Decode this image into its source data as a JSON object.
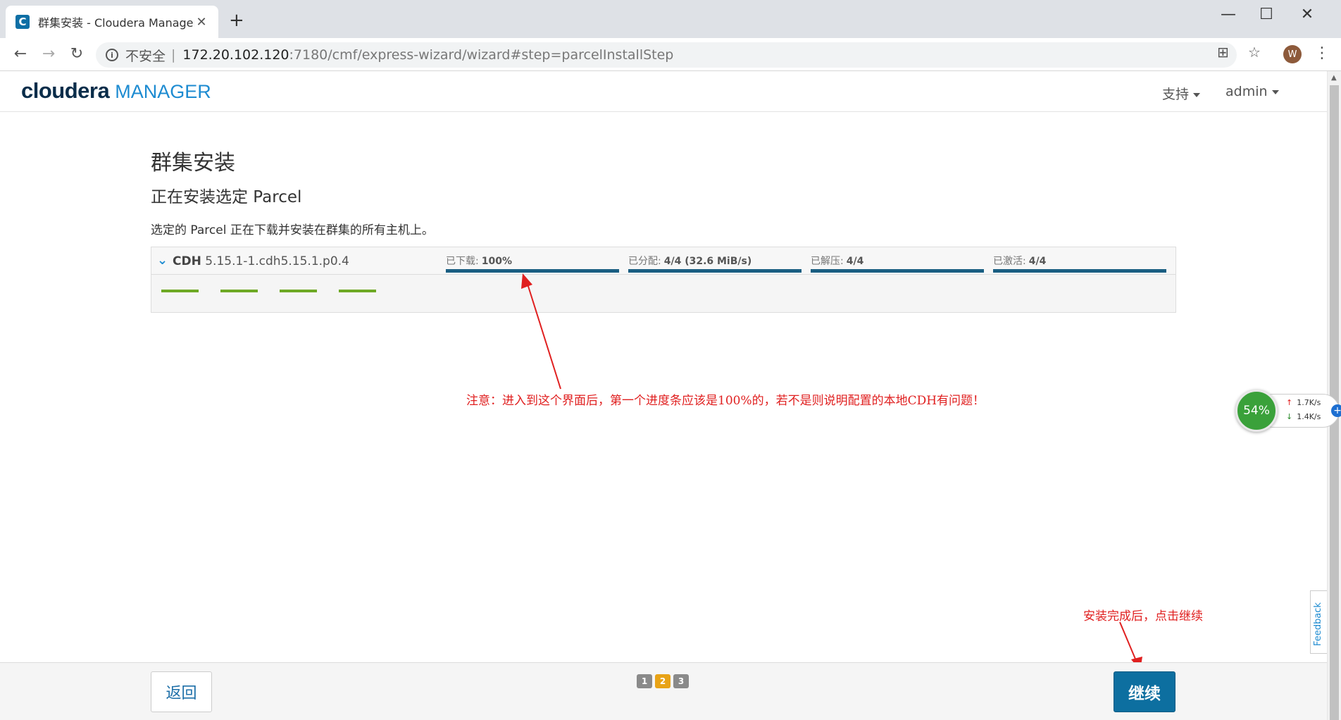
{
  "browser": {
    "tab_title": "群集安装 - Cloudera Manager",
    "tab_favicon_letter": "C",
    "insecure_label": "不安全",
    "url_host": "172.20.102.120",
    "url_path": ":7180/cmf/express-wizard/wizard#step=parcelInstallStep",
    "profile_initial": "W"
  },
  "header": {
    "logo_primary": "cloudera",
    "logo_secondary": "MANAGER",
    "support_label": "支持",
    "user_label": "admin"
  },
  "main": {
    "title": "群集安装",
    "subtitle": "正在安装选定 Parcel",
    "description": "选定的 Parcel 正在下载并安装在群集的所有主机上。"
  },
  "parcel": {
    "name_prefix": "CDH",
    "name_version": "5.15.1-1.cdh5.15.1.p0.4",
    "stages": [
      {
        "label": "已下载:",
        "value": "100%",
        "progress": 1.0
      },
      {
        "label": "已分配:",
        "value": "4/4 (32.6 MiB/s)",
        "progress": 1.0
      },
      {
        "label": "已解压:",
        "value": "4/4",
        "progress": 1.0
      },
      {
        "label": "已激活:",
        "value": "4/4",
        "progress": 1.0
      }
    ]
  },
  "annotations": {
    "note_1": "注意：进入到这个界面后，第一个进度条应该是100%的，若不是则说明配置的本地CDH有问题！",
    "note_2": "安装完成后，点击继续"
  },
  "speed_widget": {
    "percent": "54%",
    "upload": "1.7K/s",
    "download": "1.4K/s"
  },
  "feedback_label": "Feedback",
  "footer": {
    "back_label": "返回",
    "continue_label": "继续",
    "steps": [
      "1",
      "2",
      "3"
    ],
    "current_step": "2"
  },
  "colors": {
    "progress_fill": "#1a5e82",
    "continue_button": "#0d6fa0",
    "annotation": "#e02020",
    "current_step": "#e8a317"
  }
}
